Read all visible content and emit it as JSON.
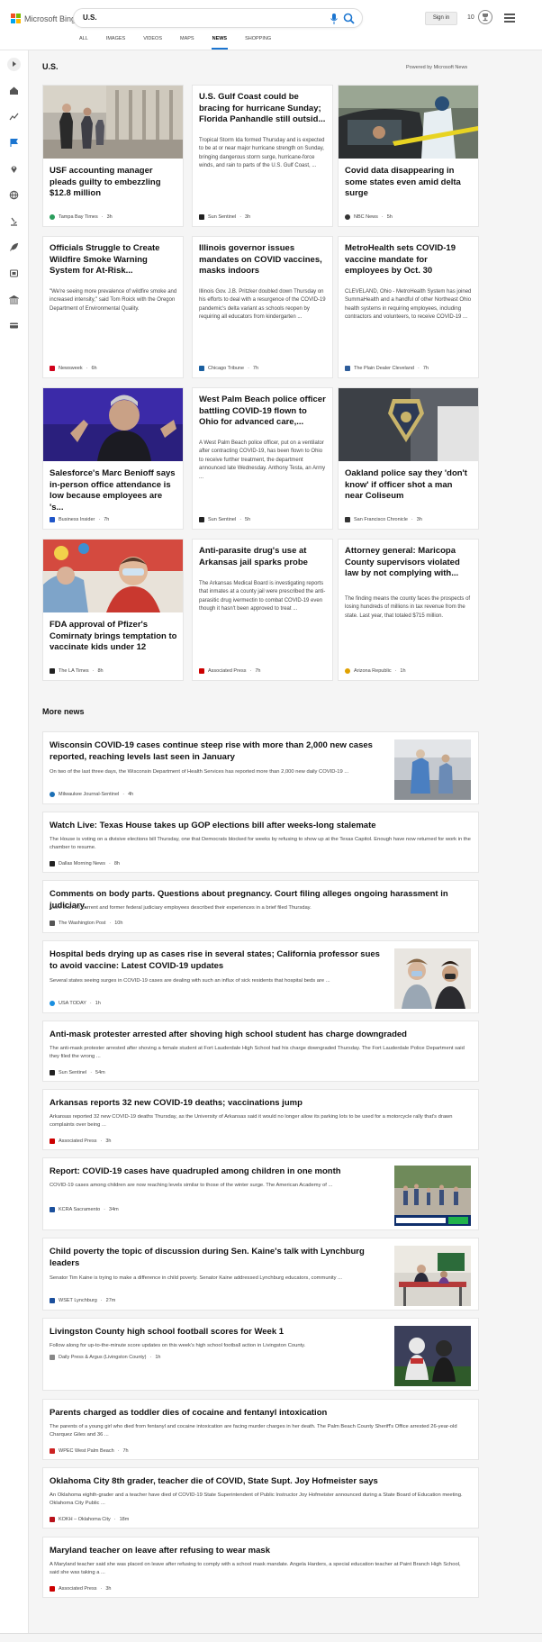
{
  "header": {
    "logo_text": "Microsoft Bing",
    "search_query": "U.S.",
    "signin_label": "Sign in",
    "rewards_count": "10",
    "tabs": [
      "ALL",
      "IMAGES",
      "VIDEOS",
      "MAPS",
      "NEWS",
      "SHOPPING"
    ],
    "active_tab": "NEWS"
  },
  "sidebar": {
    "icons": [
      "home-icon",
      "trending-icon",
      "flag-icon",
      "location-pin-icon",
      "globe-icon",
      "microscope-icon",
      "rocket-icon",
      "film-icon",
      "bank-icon",
      "credit-card-icon"
    ]
  },
  "main": {
    "section_title": "U.S.",
    "powered_by": "Powered by Microsoft News",
    "cards": [
      {
        "title": "USF accounting manager pleads guilty to embezzling $12.8 million",
        "snippet": "",
        "source": "Tampa Bay Times",
        "time": "3h",
        "has_image": true,
        "image": "men-walking-outside-courthouse",
        "source_color": "#2a9d5c"
      },
      {
        "title": "U.S. Gulf Coast could be bracing for hurricane Sunday; Florida Panhandle still outsid...",
        "snippet": "Tropical Storm Ida formed Thursday and is expected to be at or near major hurricane strength on Sunday, bringing dangerous storm surge, hurricane-force winds, and rain to parts of the U.S. Gulf Coast, ...",
        "source": "Sun Sentinel",
        "time": "3h",
        "has_image": false,
        "source_color": "#222222"
      },
      {
        "title": "Covid data disappearing in some states even amid delta surge",
        "snippet": "",
        "source": "NBC News",
        "time": "5h",
        "has_image": true,
        "image": "drive-through-covid-testing",
        "source_color": "#333333"
      },
      {
        "title": "Officials Struggle to Create Wildfire Smoke Warning System for At-Risk...",
        "snippet": "\"We're seeing more prevalence of wildfire smoke and increased intensity,\" said Tom Roick with the Oregon Department of Environmental Quality.",
        "source": "Newsweek",
        "time": "6h",
        "has_image": false,
        "source_color": "#d0021b"
      },
      {
        "title": "Illinois governor issues mandates on COVID vaccines, masks indoors",
        "snippet": "Illinois Gov. J.B. Pritzker doubled down Thursday on his efforts to deal with a resurgence of the COVID-19 pandemic's delta variant as schools reopen by requiring all educators from kindergarten ...",
        "source": "Chicago Tribune",
        "time": "7h",
        "has_image": false,
        "source_color": "#1a5fa0"
      },
      {
        "title": "MetroHealth sets COVID-19 vaccine mandate for employees by Oct. 30",
        "snippet": "CLEVELAND, Ohio - MetroHealth System has joined SummaHealth and a handful of other Northeast Ohio health systems in requiring employees, including contractors and volunteers, to receive COVID-19 ...",
        "source": "The Plain Dealer Cleveland",
        "time": "7h",
        "has_image": false,
        "source_color": "#2d5c9a"
      },
      {
        "title": "Salesforce's Marc Benioff says in-person office attendance is low because employees are 's...",
        "snippet": "",
        "source": "Business Insider",
        "time": "7h",
        "has_image": true,
        "image": "man-speaking-on-stage",
        "source_color": "#1f55c8"
      },
      {
        "title": "West Palm Beach police officer battling COVID-19 flown to Ohio for advanced care,...",
        "snippet": "A West Palm Beach police officer, put on a ventilator after contracting COVID-19, has been flown to Ohio to receive further treatment, the department announced late Wednesday. Anthony Testa, an Army ...",
        "source": "Sun Sentinel",
        "time": "5h",
        "has_image": false,
        "source_color": "#222222"
      },
      {
        "title": "Oakland police say they 'don't know' if officer shot a man near Coliseum",
        "snippet": "",
        "source": "San Francisco Chronicle",
        "time": "3h",
        "has_image": true,
        "image": "police-badge-on-car",
        "source_color": "#333333"
      },
      {
        "title": "FDA approval of Pfizer's Comirnaty brings temptation to vaccinate kids under 12",
        "snippet": "",
        "source": "The LA Times",
        "time": "8h",
        "has_image": true,
        "image": "child-receiving-vaccine",
        "source_color": "#222222"
      },
      {
        "title": "Anti-parasite drug's use at Arkansas jail sparks probe",
        "snippet": "The Arkansas Medical Board is investigating reports that inmates at a county jail were prescribed the anti-parasitic drug ivermectin to combat COVID-19 even though it hasn't been approved to treat ...",
        "source": "Associated Press",
        "time": "7h",
        "has_image": false,
        "source_color": "#cc0000"
      },
      {
        "title": "Attorney general: Maricopa County supervisors violated law by not complying with...",
        "snippet": "The finding means the county faces the prospects of losing hundreds of millions in tax revenue from the state. Last year, that totaled $715 million.",
        "source": "Arizona Republic",
        "time": "1h",
        "has_image": false,
        "source_color": "#e0a100"
      }
    ],
    "more_news_title": "More news",
    "more_news": [
      {
        "title": "Wisconsin COVID-19 cases continue steep rise with more than 2,000 new cases reported, reaching levels last seen in January",
        "snippet": "On two of the last three days, the Wisconsin Department of Health Services has reported more than 2,000 new daily COVID-19 ...",
        "source": "Milwaukee Journal-Sentinel",
        "time": "4h",
        "has_image": true,
        "image": "health-workers-in-gowns",
        "source_color": "#1b6fb5"
      },
      {
        "title": "Watch Live: Texas House takes up GOP elections bill after weeks-long stalemate",
        "snippet": "The House is voting on a divisive elections bill Thursday, one that Democrats blocked for weeks by refusing to show up at the Texas Capitol. Enough have now returned for work in the chamber to resume.",
        "source": "Dallas Morning News",
        "time": "8h",
        "has_image": false,
        "source_color": "#222222"
      },
      {
        "title": "Comments on body parts. Questions about pregnancy. Court filing alleges ongoing harassment in judiciary.",
        "snippet": "More than 20 current and former federal judiciary employees described their experiences in a brief filed Thursday.",
        "source": "The Washington Post",
        "time": "10h",
        "has_image": false,
        "source_color": "#555555"
      },
      {
        "title": "Hospital beds drying up as cases rise in several states; California professor sues to avoid vaccine: Latest COVID-19 updates",
        "snippet": "Several states seeing surges in COVID-19 cases are dealing with such an influx of sick residents that hospital beds are ...",
        "source": "USA TODAY",
        "time": "1h",
        "has_image": true,
        "image": "masked-people-vaccination",
        "source_color": "#1a8fe0"
      },
      {
        "title": "Anti-mask protester arrested after shoving high school student has charge downgraded",
        "snippet": "The anti-mask protester arrested after shoving a female student at Fort Lauderdale High School had his charge downgraded Thursday. The Fort Lauderdale Police Department said they filed the wrong ...",
        "source": "Sun Sentinel",
        "time": "54m",
        "has_image": false,
        "source_color": "#222222"
      },
      {
        "title": "Arkansas reports 32 new COVID-19 deaths; vaccinations jump",
        "snippet": "Arkansas reported 32 new COVID-19 deaths Thursday, as the University of Arkansas said it would no longer allow its parking lots to be used for a motorcycle rally that's drawn complaints over being ...",
        "source": "Associated Press",
        "time": "3h",
        "has_image": false,
        "source_color": "#cc0000"
      },
      {
        "title": "Report: COVID-19 cases have quadrupled among children in one month",
        "snippet": "COVID-19 cases among children are now reaching levels similar to those of the winter surge. The American Academy of ...",
        "source": "KCRA Sacramento",
        "time": "34m",
        "has_image": true,
        "image": "children-walking-tv-broadcast",
        "source_color": "#1b4f9c"
      },
      {
        "title": "Child poverty the topic of discussion during Sen. Kaine's talk with Lynchburg leaders",
        "snippet": "Senator Tim Kaine is trying to make a difference in child poverty. Senator Kaine addressed Lynchburg educators, community ...",
        "source": "WSET Lynchburg",
        "time": "27m",
        "has_image": true,
        "image": "classroom-meeting",
        "source_color": "#1b4f9c"
      },
      {
        "title": "Livingston County high school football scores for Week 1",
        "snippet": "Follow along for up-to-the-minute score updates on this week's high school football action in Livingston County.",
        "source": "Daily Press & Argus (Livingston County)",
        "time": "1h",
        "has_image": true,
        "image": "football-players",
        "source_color": "#888888"
      },
      {
        "title": "Parents charged as toddler dies of cocaine and fentanyl intoxication",
        "snippet": "The parents of a young girl who died from fentanyl and cocaine intoxication are facing murder charges in her death. The Palm Beach County Sheriff's Office arrested 26-year-old Charquez Giles and 36 ...",
        "source": "WPEC West Palm Beach",
        "time": "7h",
        "has_image": false,
        "source_color": "#cc2222"
      },
      {
        "title": "Oklahoma City 8th grader, teacher die of COVID, State Supt. Joy Hofmeister says",
        "snippet": "An Oklahoma eighth-grader and a teacher have died of COVID-19 State Superintendent of Public Instructor Joy Hofmeister announced during a State Board of Education meeting. Oklahoma City Public ...",
        "source": "KOKH – Oklahoma City",
        "time": "18m",
        "has_image": false,
        "source_color": "#b8121b"
      },
      {
        "title": "Maryland teacher on leave after refusing to wear mask",
        "snippet": "A Maryland teacher said she was placed on leave after refusing to comply with a school mask mandate. Angela Harders, a special education teacher at Paint Branch High School, said she was taking a ...",
        "source": "Associated Press",
        "time": "3h",
        "has_image": false,
        "source_color": "#cc0000"
      }
    ]
  },
  "colors": {
    "accent": "#1b75d0",
    "logo_red": "#f25022",
    "logo_green": "#7fba00",
    "logo_blue": "#00a4ef",
    "logo_yellow": "#ffb900"
  }
}
